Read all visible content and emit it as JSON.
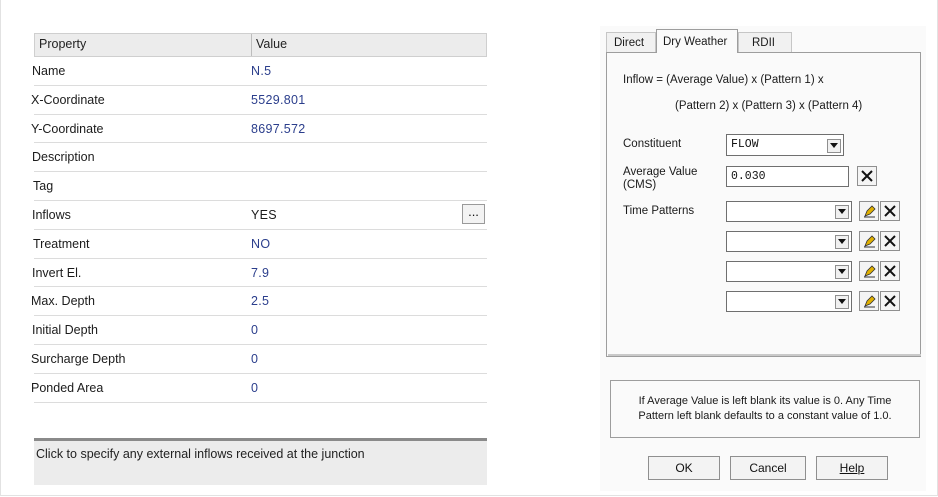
{
  "property_editor": {
    "header": {
      "property": "Property",
      "value": "Value"
    },
    "rows": [
      {
        "name": "Name",
        "value": "N.5"
      },
      {
        "name": "X-Coordinate",
        "value": "5529.801"
      },
      {
        "name": "Y-Coordinate",
        "value": "8697.572"
      },
      {
        "name": "Description",
        "value": ""
      },
      {
        "name": "Tag",
        "value": ""
      },
      {
        "name": "Inflows",
        "value": "YES",
        "button": "..."
      },
      {
        "name": "Treatment",
        "value": "NO"
      },
      {
        "name": "Invert El.",
        "value": "7.9"
      },
      {
        "name": "Max. Depth",
        "value": "2.5"
      },
      {
        "name": "Initial Depth",
        "value": "0"
      },
      {
        "name": "Surcharge Depth",
        "value": "0"
      },
      {
        "name": "Ponded Area",
        "value": "0"
      }
    ],
    "hint": "Click to specify any external inflows received at the junction"
  },
  "inflows_dialog": {
    "tabs": [
      "Direct",
      "Dry Weather",
      "RDII"
    ],
    "active_tab": "Dry Weather",
    "formula_line1": "Inflow = (Average Value) x (Pattern 1) x",
    "formula_line2": "(Pattern 2) x (Pattern 3) x (Pattern 4)",
    "constituent": {
      "label": "Constituent",
      "value": "FLOW"
    },
    "average_value": {
      "label_line1": "Average Value",
      "label_line2": "(CMS)",
      "value": "0.030"
    },
    "time_patterns": {
      "label": "Time Patterns",
      "values": [
        "",
        "",
        "",
        ""
      ]
    },
    "note_line1": "If Average Value is left blank its value is 0. Any Time",
    "note_line2": "Pattern left blank defaults to a constant value of 1.0.",
    "buttons": {
      "ok": "OK",
      "cancel": "Cancel",
      "help": "Help"
    }
  },
  "icons": [
    "ellipsis-icon",
    "chevron-down-icon",
    "edit-pencil-icon",
    "clear-x-icon"
  ],
  "colors": {
    "value_text": "#2b3e8c",
    "panel_bg": "#fafafa",
    "header_bg": "#ececec",
    "edit_icon": "#e0b000"
  }
}
